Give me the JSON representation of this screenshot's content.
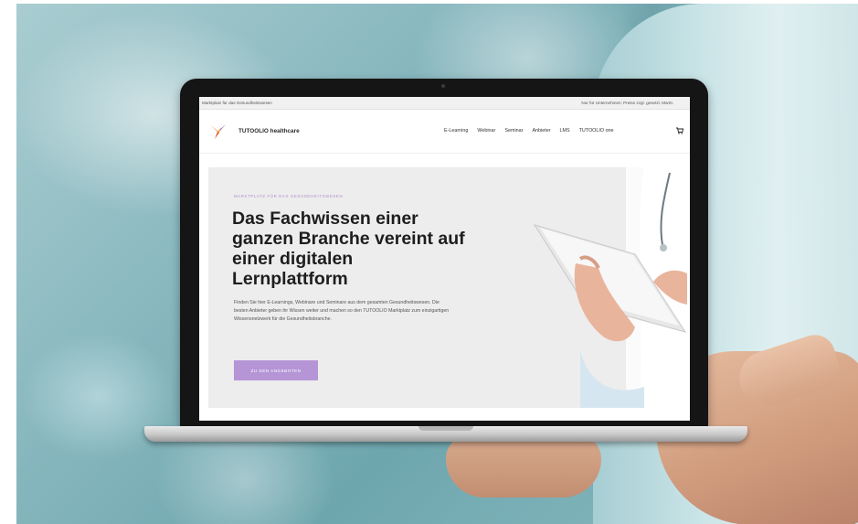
{
  "window": {
    "topbar_left": "Marktplatz für das Gesundheitswesen",
    "topbar_right": "Nur für Unternehmen: Preise zzgl. gesetzl. MwSt."
  },
  "header": {
    "brand": "TUTOOLIO healthcare",
    "nav": [
      {
        "label": "E-Learning"
      },
      {
        "label": "Webinar"
      },
      {
        "label": "Seminar"
      },
      {
        "label": "Anbieter"
      },
      {
        "label": "LMS"
      },
      {
        "label": "TUTOOLIO one"
      }
    ],
    "cart_icon": "cart-icon"
  },
  "hero": {
    "eyebrow": "MARKTPLATZ FÜR DAS GESUNDHEITSWESEN",
    "headline": "Das Fachwissen einer ganzen Branche vereint auf einer digitalen Lernplattform",
    "body": "Finden Sie hier E-Learnings, Webinare und Seminare aus dem gesamten Gesundheitswesen. Die besten Anbieter geben ihr Wissen weiter und machen so den TUTOOLIO Marktplatz zum einzigartigen Wissensnetzwerk für die Gesundheitsbranche.",
    "cta_label": "ZU DEN ANGEBOTEN"
  },
  "colors": {
    "accent": "#b595d6",
    "hero_bg": "#ededed"
  }
}
